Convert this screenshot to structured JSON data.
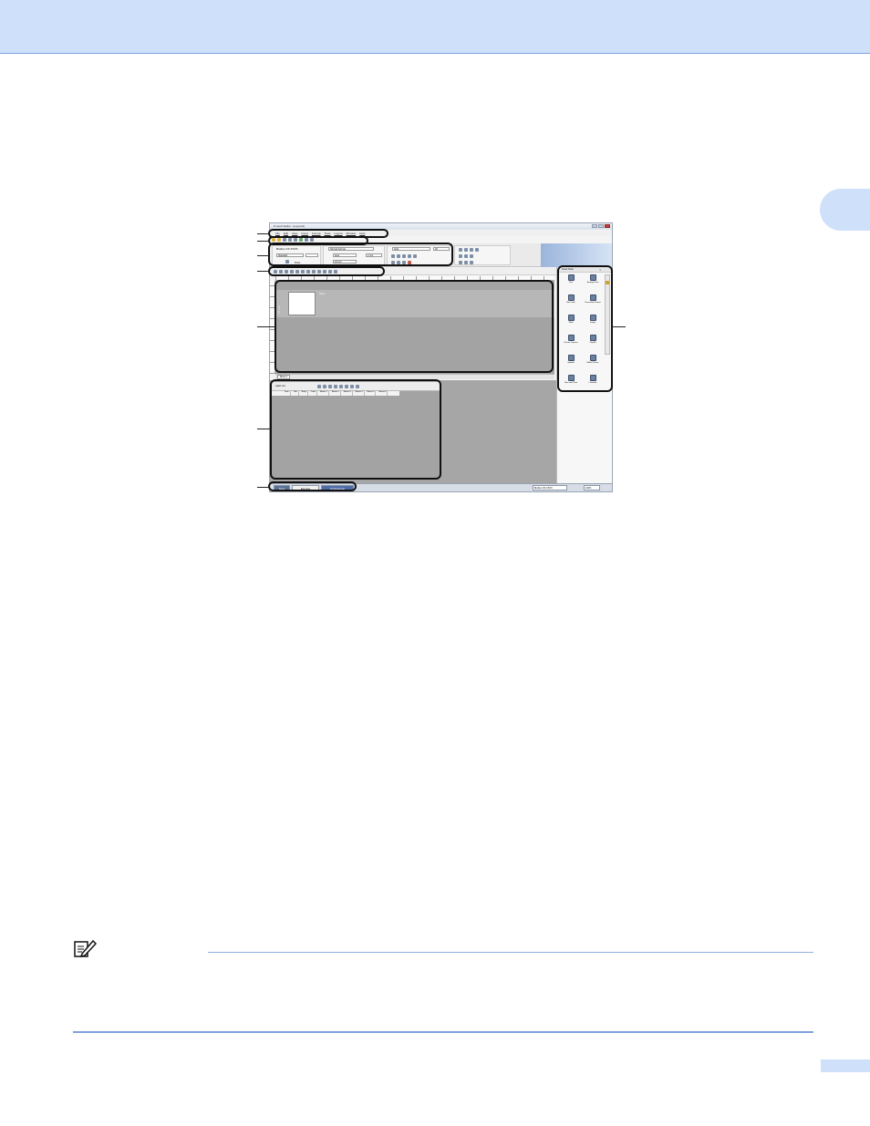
{
  "screenshot": {
    "title": "P-touch Editor - [Layout1]",
    "menu": [
      "File",
      "Edit",
      "View",
      "Insert",
      "Format",
      "Tools",
      "Layout",
      "Window",
      "Help"
    ],
    "printer": {
      "name": "Brother XX-XXXX",
      "paper": "Standard",
      "print_label": "Print"
    },
    "format": {
      "style": "Normal Format",
      "width_mode": "Auto",
      "length": "24 mm",
      "margin": "2 mm"
    },
    "font": {
      "name": "Arial",
      "size": "20"
    },
    "layout": {
      "side_label": "24 mm",
      "name": "Name",
      "sheet_tab": "Sheet 1"
    },
    "label_list": {
      "title": "Label List",
      "columns": [
        "Date",
        "Title",
        "Body",
        "Code",
        "Memo 1",
        "Memo 2",
        "Memo 3",
        "Memo 4",
        "Memo 5",
        "Memo 6"
      ]
    },
    "insert_panel": {
      "title": "Insert Tools",
      "tools": [
        "Text",
        "Arrange Text",
        "Bar Code",
        "Decorative Frame",
        "Table",
        "Image",
        "Screen Capture",
        "Clip Art",
        "Symbol",
        "Make Picture",
        "Date and Time",
        "Calendar"
      ]
    },
    "status": {
      "modes": [
        "Snap",
        "Express",
        "Professional"
      ],
      "printer": "Brother XX-XXXX",
      "zoom": "100%"
    }
  },
  "colors": {
    "header_band": "#cfe0fb",
    "rule": "#7da2dc"
  }
}
